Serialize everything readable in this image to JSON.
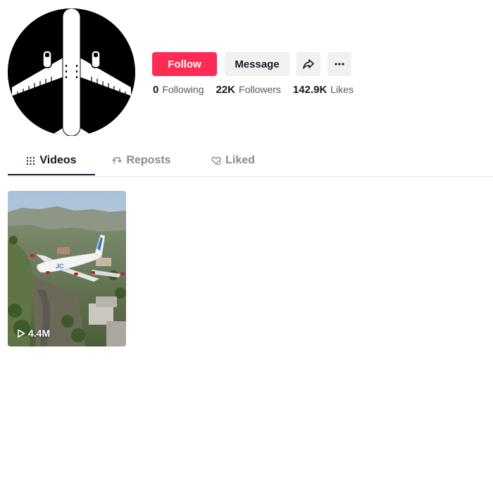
{
  "profile": {
    "avatar_icon": "airplane-icon"
  },
  "actions": {
    "follow_label": "Follow",
    "message_label": "Message",
    "share_icon": "share-icon",
    "more_icon": "more-icon"
  },
  "stats": [
    {
      "value": "0",
      "label": "Following"
    },
    {
      "value": "22K",
      "label": "Followers"
    },
    {
      "value": "142.9K",
      "label": "Likes"
    }
  ],
  "tabs": [
    {
      "label": "Videos",
      "icon": "grid-icon",
      "active": true
    },
    {
      "label": "Reposts",
      "icon": "repost-icon",
      "active": false
    },
    {
      "label": "Liked",
      "icon": "heart-icon",
      "active": false
    }
  ],
  "videos": [
    {
      "views": "4.4M",
      "thumbnail": "airplane-over-hills"
    }
  ],
  "colors": {
    "accent": "#fe2c55",
    "button_bg": "#f1f1f2",
    "text": "#161823",
    "muted": "#57585f"
  }
}
